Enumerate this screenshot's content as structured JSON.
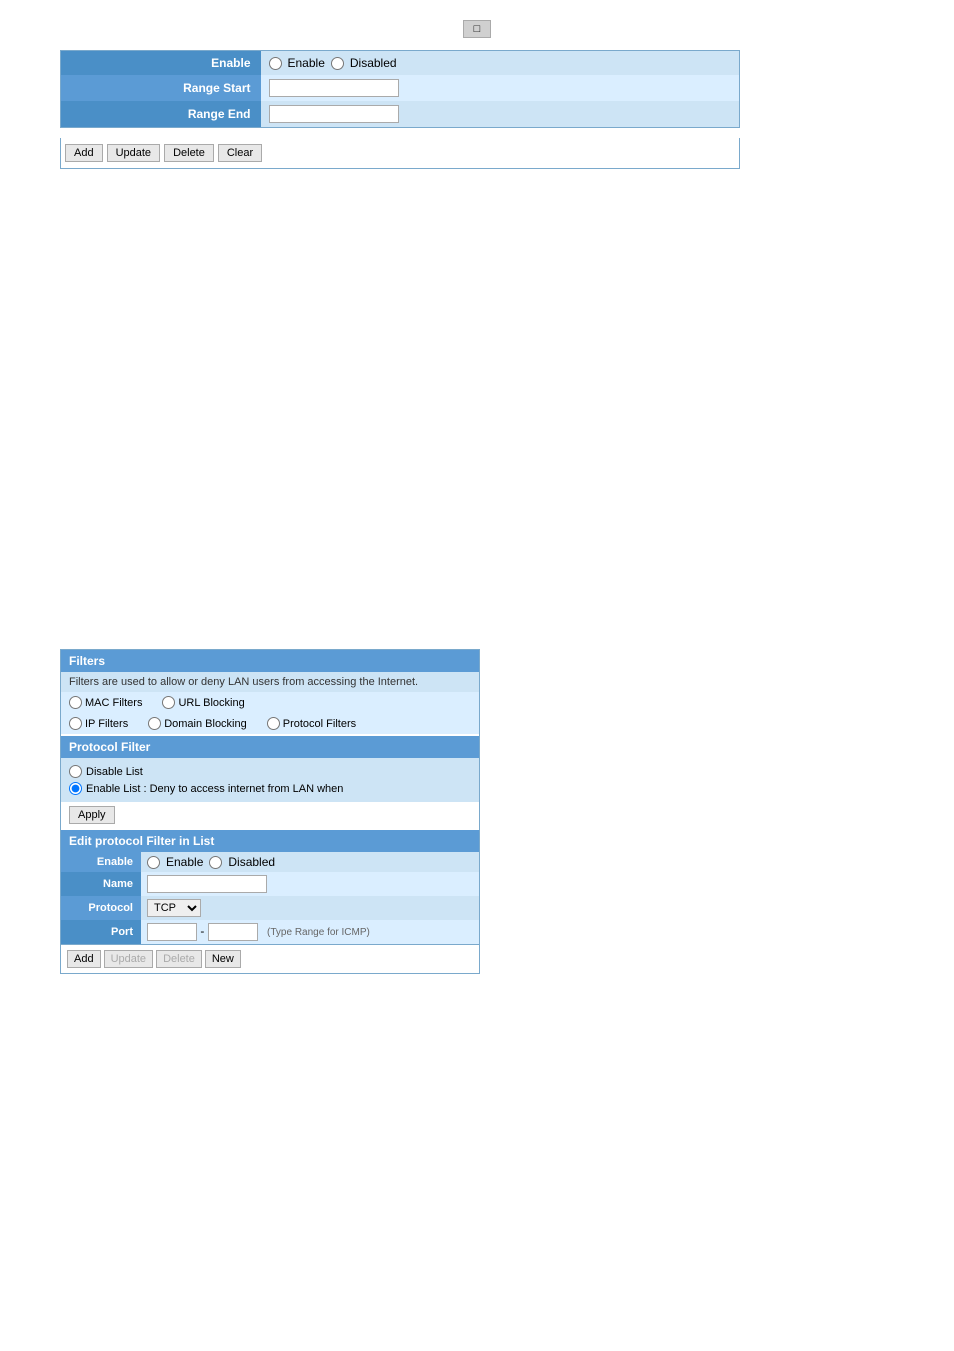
{
  "top": {
    "small_button": "□"
  },
  "form1": {
    "enable_label": "Enable",
    "enable_option": "Enable",
    "disabled_option": "Disabled",
    "range_start_label": "Range Start",
    "range_end_label": "Range End",
    "range_start_value": "",
    "range_end_value": ""
  },
  "buttons1": {
    "add": "Add",
    "update": "Update",
    "delete": "Delete",
    "clear": "Clear"
  },
  "filters": {
    "title": "Filters",
    "description": "Filters are used to allow or deny LAN users from accessing the Internet.",
    "options": [
      {
        "label": "MAC Filters"
      },
      {
        "label": "URL Blocking"
      },
      {
        "label": "IP Filters"
      },
      {
        "label": "Domain Blocking"
      },
      {
        "label": "Protocol Filters"
      }
    ],
    "protocol_filter_title": "Protocol Filter",
    "disable_list_label": "Disable List",
    "enable_list_label": "Enable List : Deny to access internet from LAN when",
    "apply_label": "Apply",
    "edit_title": "Edit protocol Filter in List",
    "edit_enable_label": "Enable",
    "edit_enable_option": "Enable",
    "edit_disabled_option": "Disabled",
    "edit_name_label": "Name",
    "edit_name_value": "",
    "edit_protocol_label": "Protocol",
    "edit_protocol_value": "TCP",
    "edit_port_label": "Port",
    "edit_port_value": "",
    "edit_port_range": "",
    "edit_port_note": "(Type Range for ICMP)",
    "edit_buttons": {
      "add": "Add",
      "update": "Update",
      "delete": "Delete",
      "new_btn": "New"
    }
  }
}
